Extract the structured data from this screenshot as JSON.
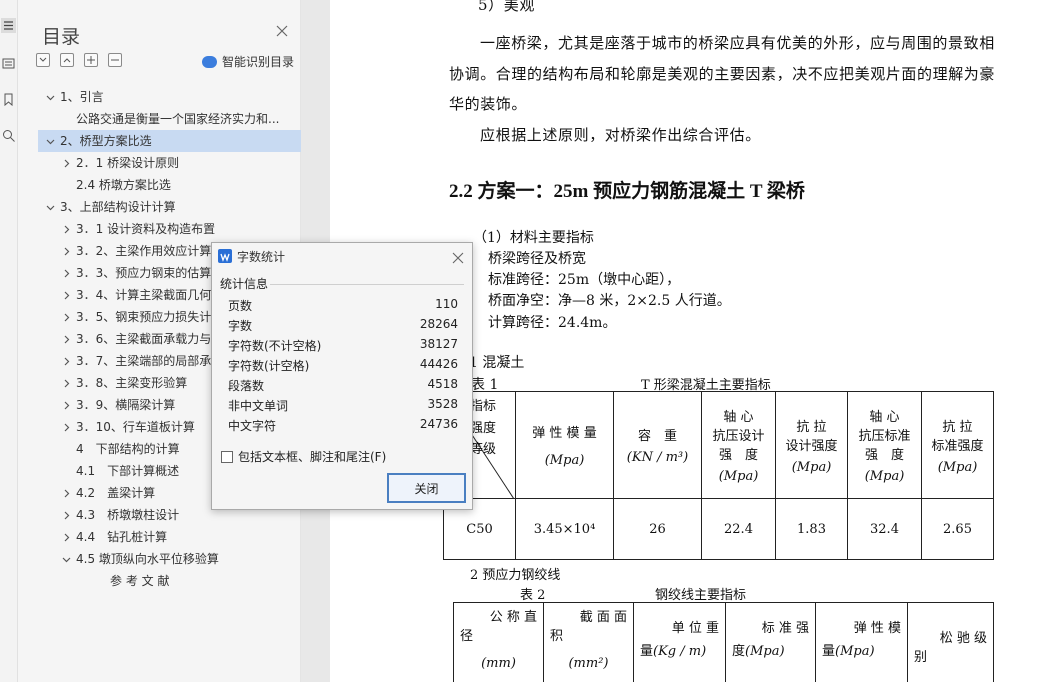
{
  "nav": {
    "title": "目录",
    "smart_toc": "智能识别目录",
    "items": [
      {
        "label": "1、引言",
        "level": 0,
        "arrow": "down"
      },
      {
        "label": "公路交通是衡量一个国家经济实力和...",
        "level": 2,
        "arrow": "none"
      },
      {
        "label": "2、桥型方案比选",
        "level": 0,
        "arrow": "down",
        "selected": true
      },
      {
        "label": "2．1 桥梁设计原则",
        "level": 1,
        "arrow": "right"
      },
      {
        "label": "2.4 桥墩方案比选",
        "level": 2,
        "arrow": "none"
      },
      {
        "label": "3、上部结构设计计算",
        "level": 0,
        "arrow": "down"
      },
      {
        "label": "3．1 设计资料及构造布置",
        "level": 1,
        "arrow": "right"
      },
      {
        "label": "3．2、主梁作用效应计算",
        "level": 1,
        "arrow": "right"
      },
      {
        "label": "3．3、预应力钢束的估算",
        "level": 1,
        "arrow": "right"
      },
      {
        "label": "3．4、计算主梁截面几何",
        "level": 1,
        "arrow": "right"
      },
      {
        "label": "3．5、钢束预应力损失计",
        "level": 1,
        "arrow": "right"
      },
      {
        "label": "3．6、主梁截面承载力与",
        "level": 1,
        "arrow": "right"
      },
      {
        "label": "3．7、主梁端部的局部承",
        "level": 1,
        "arrow": "right"
      },
      {
        "label": "3．8、主梁变形验算",
        "level": 1,
        "arrow": "right"
      },
      {
        "label": "3．9、横隔梁计算",
        "level": 1,
        "arrow": "right"
      },
      {
        "label": "3．10、行车道板计算",
        "level": 1,
        "arrow": "right"
      },
      {
        "label": "4　下部结构的计算",
        "level": 2,
        "arrow": "none"
      },
      {
        "label": "4.1　下部计算概述",
        "level": 2,
        "arrow": "none"
      },
      {
        "label": "4.2　盖梁计算",
        "level": 1,
        "arrow": "right"
      },
      {
        "label": "4.3　桥墩墩柱设计",
        "level": 1,
        "arrow": "right"
      },
      {
        "label": "4.4　钻孔桩计算",
        "level": 1,
        "arrow": "right"
      },
      {
        "label": "4.5 墩顶纵向水平位移验算",
        "level": 1,
        "arrow": "down"
      },
      {
        "label": "参 考 文 献",
        "level": 3,
        "arrow": "none"
      }
    ]
  },
  "doc": {
    "top_cut": "5）美观",
    "para1_line1": "一座桥梁，尤其是座落于城市的桥梁应具有优美的外形，应与周围的景致相",
    "para1_line2": "协调。合理的结构布局和轮廓是美观的主要因素，决不应把美观片面的理解为豪",
    "para1_line3": "华的装饰。",
    "para2": "应根据上述原则，对桥梁作出综合评估。",
    "heading": "2.2 方案一：25m 预应力钢筋混凝土 T 梁桥",
    "sub1": "（1）材料主要指标",
    "span_title": "桥梁跨径及桥宽",
    "span1": "标准跨径：25m（墩中心距），",
    "span2": "桥面净空：净—8 米，2×2.5 人行道。",
    "span3": "计算跨径：24.4m。",
    "concrete": "1 混凝土",
    "table1_no": "表 1",
    "table1_caption": "T 形梁混凝土主要指标",
    "table1": {
      "corner_a": "指标",
      "corner_b": "强度",
      "corner_c": "等级",
      "h_modulus": "弹 性 模 量",
      "h_modulus_unit": "(Mpa)",
      "h_density": "容　重",
      "h_density_unit": "(KN / m³)",
      "h_axial_design_1": "轴 心",
      "h_axial_design_2": "抗压设计",
      "h_axial_design_3": "强　度",
      "h_axial_design_unit": "(Mpa)",
      "h_tension_design_1": "抗 拉",
      "h_tension_design_2": "设计强度",
      "h_tension_design_unit": "(Mpa)",
      "h_axial_std_1": "轴 心",
      "h_axial_std_2": "抗压标准",
      "h_axial_std_3": "强　度",
      "h_axial_std_unit": "(Mpa)",
      "h_tension_std_1": "抗 拉",
      "h_tension_std_2": "标准强度",
      "h_tension_std_unit": "(Mpa)",
      "row": {
        "grade": "C50",
        "modulus": "3.45×10⁴",
        "density": "26",
        "axial_design": "22.4",
        "tension_design": "1.83",
        "axial_std": "32.4",
        "tension_std": "2.65"
      }
    },
    "strand": "2 预应力钢绞线",
    "table2_no": "表 2",
    "table2_caption": "钢绞线主要指标",
    "table2": {
      "h_dia_1": "公 称 直",
      "h_dia_2": "径",
      "h_dia_unit": "(mm)",
      "h_area_1": "截 面 面",
      "h_area_2": "积",
      "h_area_unit": "(mm²)",
      "h_weight_1": "单 位 重",
      "h_weight_2": "量",
      "h_weight_unit": "(Kg / m)",
      "h_std_1": "标 准 强",
      "h_std_2": "度",
      "h_std_unit": "(Mpa)",
      "h_mod_1": "弹 性 模",
      "h_mod_2": "量",
      "h_mod_unit": "(Mpa)",
      "h_relax_1": "松 驰 级",
      "h_relax_2": "别"
    }
  },
  "dialog": {
    "title": "字数统计",
    "section": "统计信息",
    "stats": [
      {
        "label": "页数",
        "value": "110"
      },
      {
        "label": "字数",
        "value": "28264"
      },
      {
        "label": "字符数(不计空格)",
        "value": "38127"
      },
      {
        "label": "字符数(计空格)",
        "value": "44426"
      },
      {
        "label": "段落数",
        "value": "4518"
      },
      {
        "label": "非中文单词",
        "value": "3528"
      },
      {
        "label": "中文字符",
        "value": "24736"
      }
    ],
    "checkbox_label": "包括文本框、脚注和尾注(F)",
    "close_button": "关闭"
  },
  "colors": {
    "selection": "#c8daf2",
    "accent": "#3b7ddd",
    "dialog_button_border": "#4a7fc1"
  }
}
